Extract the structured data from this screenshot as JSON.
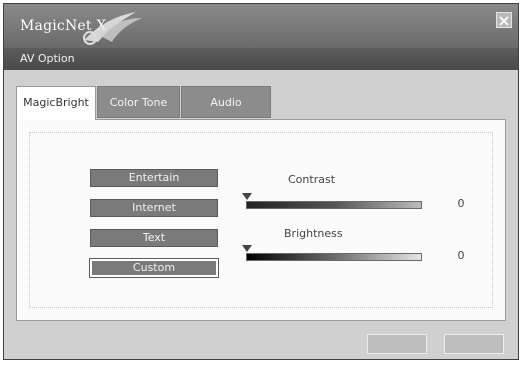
{
  "app": {
    "brand": "MagicNet X",
    "window_title": "AV Option"
  },
  "tabs": [
    {
      "label": "MagicBright",
      "active": true
    },
    {
      "label": "Color Tone",
      "active": false
    },
    {
      "label": "Audio",
      "active": false
    }
  ],
  "magicbright": {
    "modes": [
      "Entertain",
      "Internet",
      "Text",
      "Custom"
    ],
    "selected_mode": "Custom",
    "contrast": {
      "label": "Contrast",
      "value": "0"
    },
    "brightness": {
      "label": "Brightness",
      "value": "0"
    }
  },
  "footer": {
    "buttons": [
      "",
      ""
    ]
  },
  "icons": {
    "logo": "magicnet-swoosh-icon",
    "close": "close-icon"
  }
}
